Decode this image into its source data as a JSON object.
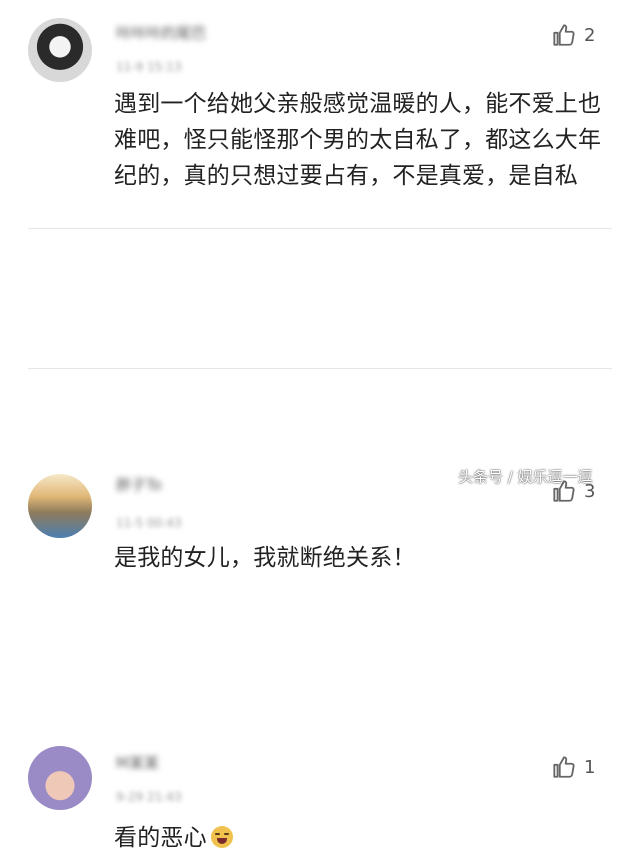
{
  "comments": [
    {
      "username": "咔咔咔的尾巴",
      "time": "11-9 15:13",
      "likes": "2",
      "text": "遇到一个给她父亲般感觉温暖的人，能不爱上也难吧，怪只能怪那个男的太自私了，都这么大年纪的，真的只想过要占有，不是真爱，是自私"
    },
    {
      "username": "胖子To",
      "time": "11-5 00:43",
      "likes": "3",
      "text": "是我的女儿，我就断绝关系！"
    },
    {
      "username": "M某某",
      "time": "9-29 21:43",
      "likes": "1",
      "text": "看的恶心"
    }
  ],
  "watermark": "头条号 / 娱乐逗一逗",
  "icons": {
    "like": "thumbs-up-icon",
    "emoji": "crying-laughing-emoji-icon"
  }
}
